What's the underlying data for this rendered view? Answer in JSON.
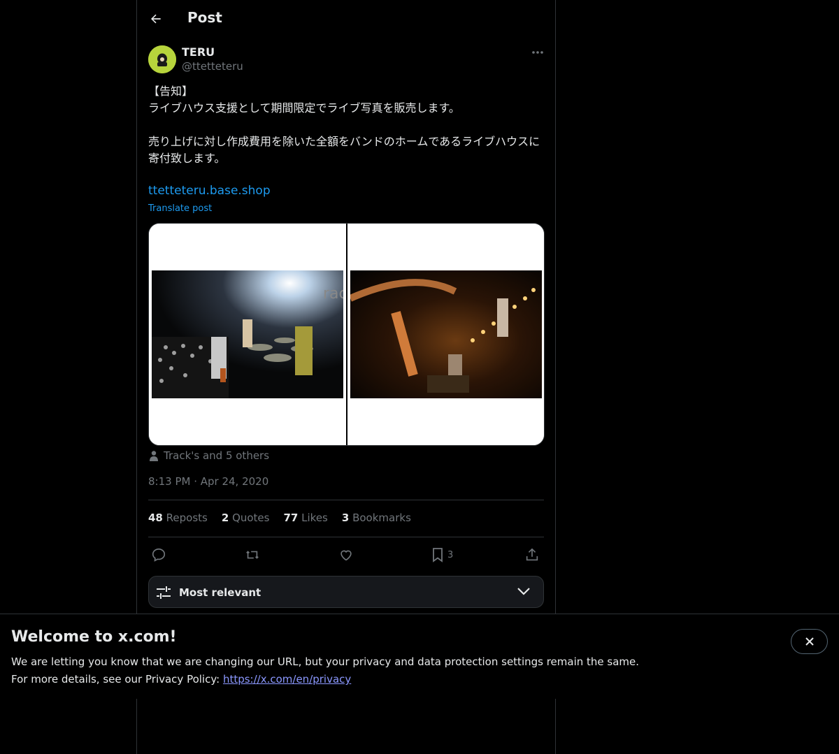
{
  "header": {
    "title": "Post"
  },
  "author": {
    "name": "TERU",
    "handle": "@ttetteteru"
  },
  "post": {
    "text": "【告知】\nライブハウス支援として期間限定でライブ写真を販売します。\n\n売り上げに対し作成費用を除いた全額をバンドのホームであるライブハウスに寄付致します。",
    "link": "ttetteteru.base.shop",
    "translate_label": "Translate post",
    "tagged": "Track's and 5 others",
    "timestamp": "8:13 PM · Apr 24, 2020"
  },
  "stats": {
    "reposts_count": "48",
    "reposts_label": "Reposts",
    "quotes_count": "2",
    "quotes_label": "Quotes",
    "likes_count": "77",
    "likes_label": "Likes",
    "bookmarks_count": "3",
    "bookmarks_label": "Bookmarks"
  },
  "actions": {
    "bookmark_count": "3"
  },
  "sort": {
    "label": "Most relevant"
  },
  "banner": {
    "title": "Welcome to x.com!",
    "line1": "We are letting you know that we are changing our URL, but your privacy and data protection settings remain the same.",
    "line2_prefix": "For more details, see our Privacy Policy: ",
    "link": "https://x.com/en/privacy"
  },
  "colors": {
    "accent": "#1d9bf0",
    "muted": "#71767b",
    "border": "#2f3336",
    "background": "#000000"
  }
}
